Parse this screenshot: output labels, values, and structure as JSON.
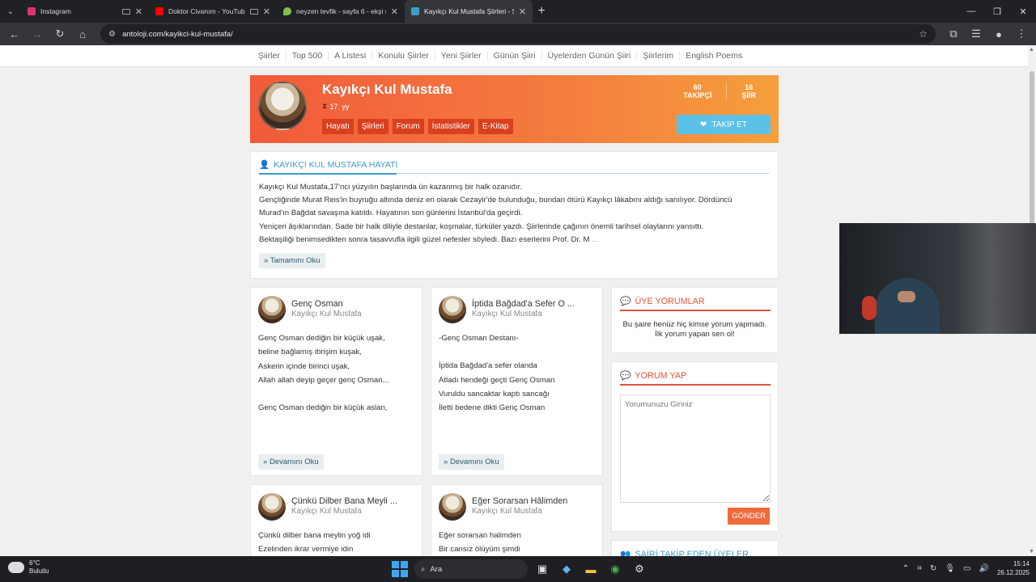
{
  "browser": {
    "tabs": [
      {
        "label": "Instagram",
        "color": "#e1306c"
      },
      {
        "label": "Doktor Civanım - YouTube",
        "color": "#ff0000"
      },
      {
        "label": "neyzen tevfik - sayfa 6 - ekşi sö",
        "color": "#81c14b"
      },
      {
        "label": "Kayıkçı Kul Mustafa Şiirleri - Şa",
        "color": "#3e9cc9"
      }
    ],
    "url": "antoloji.com/kayikci-kul-mustafa/"
  },
  "nav": {
    "items": [
      "Şiirler",
      "Top 500",
      "A Listesi",
      "Konulu Şiirler",
      "Yeni Şiirler",
      "Günün Şiiri",
      "Üyelerden Günün Şiiri",
      "Şiirlerim",
      "English Poems"
    ]
  },
  "poet": {
    "name": "Kayıkçı Kul Mustafa",
    "era": "17. yy",
    "tabs": [
      "Hayatı",
      "Şiirleri",
      "Forum",
      "İstatistikler",
      "E-Kitap"
    ],
    "followers_count": "60",
    "followers_label": "TAKİPÇİ",
    "poems_count": "16",
    "poems_label": "ŞİİR",
    "follow_label": "TAKİP ET"
  },
  "bio": {
    "heading": "KAYIKÇI KUL MUSTAFA HAYATI",
    "lines": [
      "Kayıkçı Kul Mustafa,17'nci yüzyılın başlarında ün kazanmış bir halk ozanıdır.",
      "Gençliğinde Murat Reis'in buyruğu altında deniz eri olarak Cezayir'de bulunduğu, bundan ötürü Kayıkçı lâkabını aldığı sanılıyor. Dördüncü",
      "Murad'ın Bağdat savaşına katıldı. Hayatının son günlerini İstanbul'da geçirdi.",
      "Yeniçeri âşıklarından. Sade bir halk diliyle destanlar, koşmalar, türküler yazdı. Şiirlerinde çağının önemli tarihsel olaylarını yansıttı.",
      "Bektaşiliği benimsedikten sonra tasavvufla ilgili güzel nefesler söyledi. Bazı eserlerini Prof. Dr. M"
    ],
    "ellipsis": " ...",
    "read_all": "Tamamını Oku"
  },
  "poems": [
    {
      "title": "Genç Osman",
      "author": "Kayıkçı Kul Mustafa",
      "lines": [
        "Genç Osman dediğin bir küçük uşak,",
        "beline bağlamış ibrişim kuşak,",
        "Askerin içinde birinci uşak,",
        "Allah allah deyip geçer genç Osman...",
        "",
        "Genç Osman dediğin bir küçük aslan,"
      ],
      "more": "Devamını Oku"
    },
    {
      "title": "İptida Bağdad'a Sefer O ...",
      "author": "Kayıkçı Kul Mustafa",
      "lines": [
        "-Genç Osman Destanı-",
        "",
        "İptida Bağdad'a sefer olanda",
        "Atladı hendeği geçti Genç Osman",
        "Vuruldu sancaktar kaptı sancağı",
        "İletti bedene dikti Genç Osman"
      ],
      "more": "Devamını Oku"
    },
    {
      "title": "Çünkü Dilber Bana Meyli ...",
      "author": "Kayıkçı Kul Mustafa",
      "lines": [
        "Çünkü dilber bana meylin yoğ idi",
        "Ezelinden ikrar vermiye idin"
      ],
      "more": ""
    },
    {
      "title": "Eğer Sorarsan Hâlimden",
      "author": "Kayıkçı Kul Mustafa",
      "lines": [
        "Eğer sorarsan halimden",
        "Bir cansız ölüyüm şimdi"
      ],
      "more": ""
    }
  ],
  "comments": {
    "heading": "ÜYE YORUMLAR",
    "empty_line1": "Bu şaire henüz hiç kimse yorum yapmadı.",
    "empty_line2": "İlk yorum yapan sen ol!"
  },
  "comment_form": {
    "heading": "YORUM YAP",
    "placeholder": "Yorumunuzu Giriniz",
    "submit": "GÖNDER"
  },
  "followers_panel": {
    "heading": "ŞAİRİ TAKİP EDEN ÜYELER"
  },
  "taskbar": {
    "weather_temp": "6°C",
    "weather_desc": "Bulutlu",
    "search": "Ara",
    "time": "15:14",
    "date": "26.12.2025"
  }
}
